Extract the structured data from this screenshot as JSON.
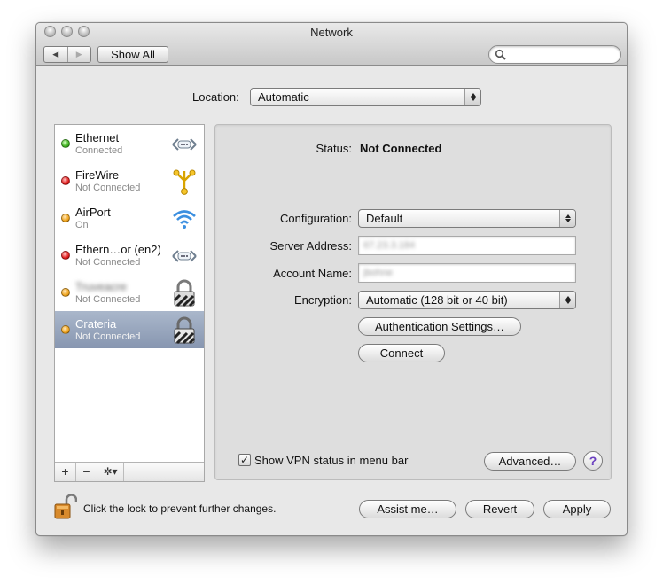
{
  "window": {
    "title": "Network"
  },
  "toolbar": {
    "back_icon": "back-arrow-icon",
    "forward_icon": "forward-arrow-icon",
    "show_all_label": "Show All",
    "search_placeholder": ""
  },
  "location": {
    "label": "Location:",
    "value": "Automatic"
  },
  "services": [
    {
      "name": "Ethernet",
      "status": "Connected",
      "dot": "green",
      "icon": "ethernet-icon"
    },
    {
      "name": "FireWire",
      "status": "Not Connected",
      "dot": "red",
      "icon": "firewire-icon"
    },
    {
      "name": "AirPort",
      "status": "On",
      "dot": "orange",
      "icon": "airport-wifi-icon"
    },
    {
      "name": "Ethern…or (en2)",
      "status": "Not Connected",
      "dot": "red",
      "icon": "ethernet-icon"
    },
    {
      "name": "Truveacre",
      "status": "Not Connected",
      "dot": "orange",
      "icon": "vpn-lock-icon"
    },
    {
      "name": "Crateria",
      "status": "Not Connected",
      "dot": "orange",
      "icon": "vpn-lock-icon",
      "selected": true
    }
  ],
  "sidebar_tools": {
    "add": "+",
    "remove": "−",
    "action": "✲▾"
  },
  "detail": {
    "status_label": "Status:",
    "status_value": "Not Connected",
    "configuration_label": "Configuration:",
    "configuration_value": "Default",
    "server_address_label": "Server Address:",
    "server_address_value": "67.23.3.184",
    "account_name_label": "Account Name:",
    "account_name_value": "jbohne",
    "encryption_label": "Encryption:",
    "encryption_value": "Automatic (128 bit or 40 bit)",
    "auth_settings_label": "Authentication Settings…",
    "connect_label": "Connect",
    "show_vpn_label": "Show VPN status in menu bar",
    "show_vpn_checked": true,
    "advanced_label": "Advanced…",
    "help_label": "?"
  },
  "footer": {
    "lock_text": "Click the lock to prevent further changes.",
    "assist_label": "Assist me…",
    "revert_label": "Revert",
    "apply_label": "Apply"
  }
}
